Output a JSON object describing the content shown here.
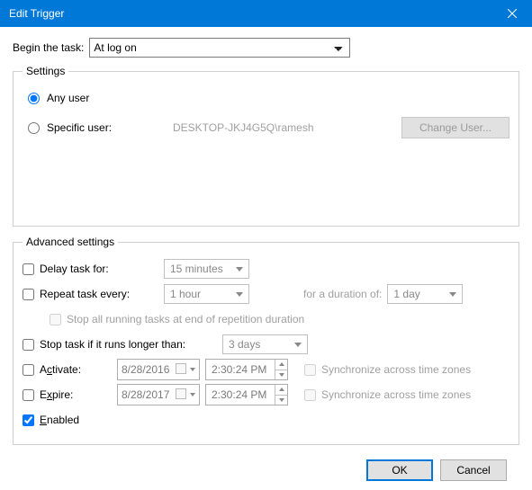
{
  "window": {
    "title": "Edit Trigger"
  },
  "begin": {
    "label": "Begin the task:",
    "value": "At log on"
  },
  "settings": {
    "legend": "Settings",
    "any_user": "Any user",
    "specific_user": "Specific user:",
    "user_value": "DESKTOP-JKJ4G5Q\\ramesh",
    "change_user": "Change User..."
  },
  "advanced": {
    "legend": "Advanced settings",
    "delay_label": "Delay task for:",
    "delay_value": "15 minutes",
    "repeat_label": "Repeat task every:",
    "repeat_value": "1 hour",
    "duration_label": "for a duration of:",
    "duration_value": "1 day",
    "stop_all": "Stop all running tasks at end of repetition duration",
    "stop_if_label": "Stop task if it runs longer than:",
    "stop_if_value": "3 days",
    "activate_label_pre": "A",
    "activate_label_u": "c",
    "activate_label_post": "tivate:",
    "activate_date": "8/28/2016",
    "activate_time": "2:30:24 PM",
    "expire_label_pre": "E",
    "expire_label_u": "x",
    "expire_label_post": "pire:",
    "expire_date": "8/28/2017",
    "expire_time": "2:30:24 PM",
    "sync_label": "Synchronize across time zones",
    "enabled_label_u": "E",
    "enabled_label_post": "nabled"
  },
  "footer": {
    "ok": "OK",
    "cancel": "Cancel"
  }
}
